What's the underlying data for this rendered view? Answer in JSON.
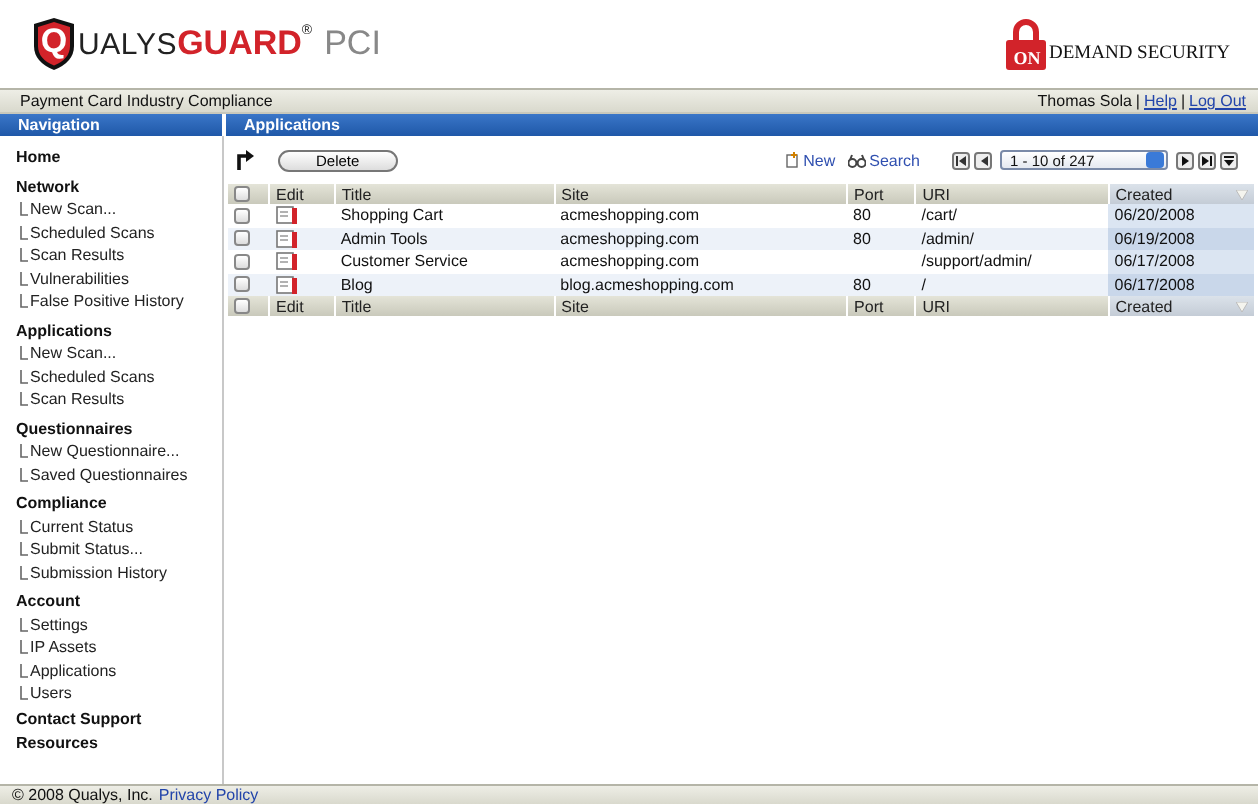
{
  "header": {
    "logo": {
      "letter": "Q",
      "brand": "UALYS",
      "brand_accent": "GUARD",
      "mark": "®",
      "product": "PCI"
    },
    "partner_logo": {
      "badge": "ON",
      "text": "DEMAND SECURITY"
    }
  },
  "top_bar": {
    "title": "Payment Card Industry Compliance",
    "user": "Thomas Sola",
    "separator_1": "|",
    "help": "Help",
    "separator_2": "|",
    "logout": "Log Out"
  },
  "sidebar": {
    "title": "Navigation",
    "sections": [
      {
        "label": "Home"
      },
      {
        "label": "Network",
        "children": [
          {
            "label": "New Scan..."
          },
          {
            "label": "Scheduled Scans"
          },
          {
            "label": "Scan Results"
          },
          {
            "label": "Vulnerabilities"
          },
          {
            "label": "False Positive History"
          }
        ]
      },
      {
        "label": "Applications",
        "children": [
          {
            "label": "New Scan..."
          },
          {
            "label": "Scheduled Scans"
          },
          {
            "label": "Scan Results"
          }
        ]
      },
      {
        "label": "Questionnaires",
        "children": [
          {
            "label": "New Questionnaire..."
          },
          {
            "label": "Saved Questionnaires"
          }
        ]
      },
      {
        "label": "Compliance",
        "children": [
          {
            "label": "Current Status"
          },
          {
            "label": "Submit Status..."
          },
          {
            "label": "Submission History"
          }
        ]
      },
      {
        "label": "Account",
        "children": [
          {
            "label": "Settings"
          },
          {
            "label": "IP Assets"
          },
          {
            "label": "Applications"
          },
          {
            "label": "Users"
          }
        ]
      },
      {
        "label": "Contact Support"
      },
      {
        "label": "Resources"
      }
    ]
  },
  "content": {
    "title": "Applications",
    "toolbar": {
      "delete": "Delete",
      "new": "New",
      "search": "Search",
      "pager": "1 - 10 of 247"
    },
    "table": {
      "select_all_checked": false,
      "columns": [
        {
          "label": "Edit",
          "sorted": false
        },
        {
          "label": "Title",
          "sorted": false
        },
        {
          "label": "Site",
          "sorted": false
        },
        {
          "label": "Port",
          "sorted": false
        },
        {
          "label": "URI",
          "sorted": false
        },
        {
          "label": "Created",
          "sorted": true
        }
      ],
      "rows": [
        {
          "checked": false,
          "title": "Shopping Cart",
          "site": "acmeshopping.com",
          "port": "80",
          "uri": "/cart/",
          "created": "06/20/2008"
        },
        {
          "checked": false,
          "title": "Admin Tools",
          "site": "acmeshopping.com",
          "port": "80",
          "uri": "/admin/",
          "created": "06/19/2008"
        },
        {
          "checked": false,
          "title": "Customer Service",
          "site": "acmeshopping.com",
          "port": "",
          "uri": "/support/admin/",
          "created": "06/17/2008"
        },
        {
          "checked": false,
          "title": "Blog",
          "site": "blog.acmeshopping.com",
          "port": "80",
          "uri": "/",
          "created": "06/17/2008"
        }
      ],
      "footer_select_all_checked": false,
      "footer_columns": [
        {
          "label": "Edit",
          "sorted": false
        },
        {
          "label": "Title",
          "sorted": false
        },
        {
          "label": "Site",
          "sorted": false
        },
        {
          "label": "Port",
          "sorted": false
        },
        {
          "label": "URI",
          "sorted": false
        },
        {
          "label": "Created",
          "sorted": true
        }
      ]
    }
  },
  "footer": {
    "copyright": "© 2008 Qualys, Inc.",
    "privacy": "Privacy Policy"
  }
}
